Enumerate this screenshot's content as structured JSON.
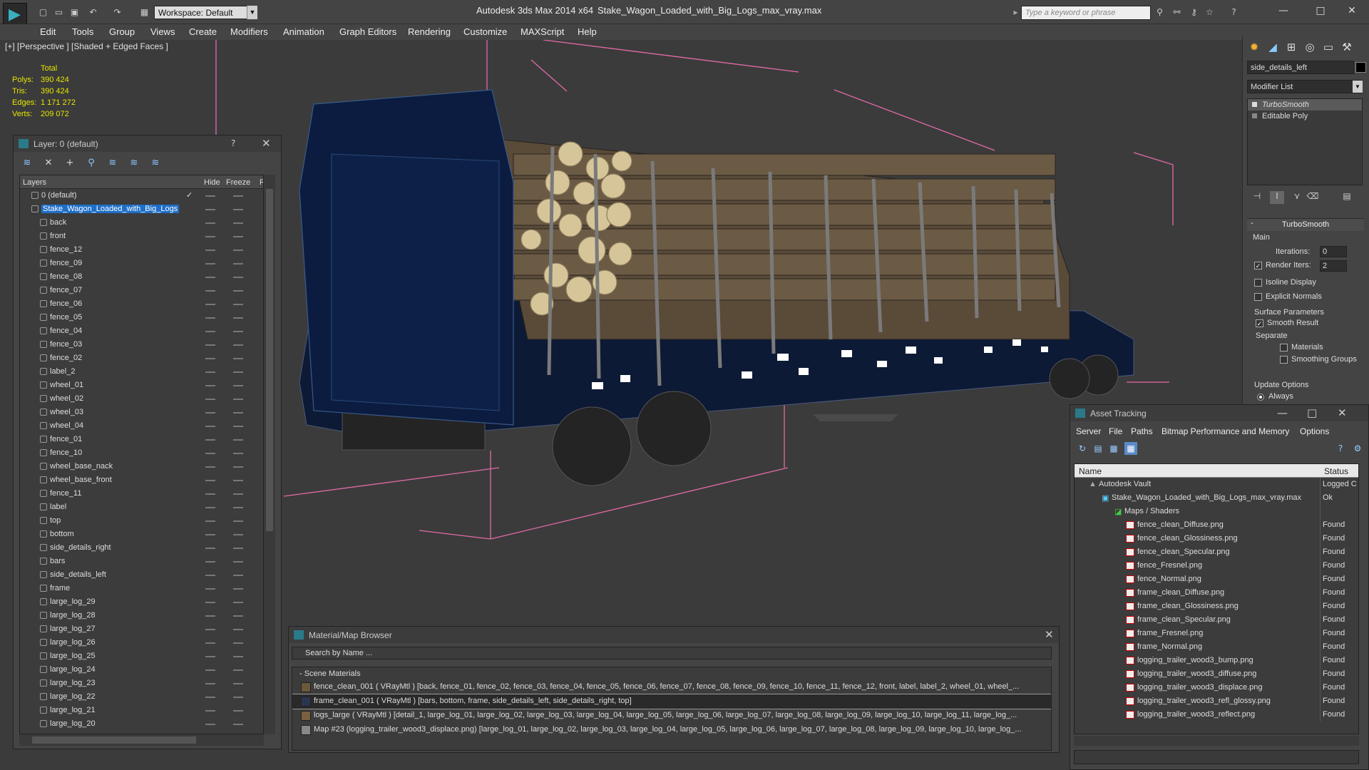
{
  "app": {
    "title": "Autodesk 3ds Max  2014 x64",
    "file": "Stake_Wagon_Loaded_with_Big_Logs_max_vray.max",
    "workspace": "Workspace: Default",
    "search_placeholder": "Type a keyword or phrase"
  },
  "menu": [
    "Edit",
    "Tools",
    "Group",
    "Views",
    "Create",
    "Modifiers",
    "Animation",
    "Graph Editors",
    "Rendering",
    "Customize",
    "MAXScript",
    "Help"
  ],
  "viewport": {
    "label": "[+] [Perspective ] [Shaded + Edged Faces ]",
    "stats_header": "Total",
    "stats": [
      {
        "label": "Polys:",
        "value": "390 424"
      },
      {
        "label": "Tris:",
        "value": "390 424"
      },
      {
        "label": "Edges:",
        "value": "1 171 272"
      },
      {
        "label": "Verts:",
        "value": "209 072"
      }
    ]
  },
  "layer_panel": {
    "title": "Layer: 0 (default)",
    "help": "?",
    "close": "✕",
    "col_layers": "Layers",
    "col_hide": "Hide",
    "col_freeze": "Freeze",
    "col_r": "R",
    "layers": [
      "0 (default)",
      "Stake_Wagon_Loaded_with_Big_Logs",
      "back",
      "front",
      "fence_12",
      "fence_09",
      "fence_08",
      "fence_07",
      "fence_06",
      "fence_05",
      "fence_04",
      "fence_03",
      "fence_02",
      "label_2",
      "wheel_01",
      "wheel_02",
      "wheel_03",
      "wheel_04",
      "fence_01",
      "fence_10",
      "wheel_base_nack",
      "wheel_base_front",
      "fence_11",
      "label",
      "top",
      "bottom",
      "side_details_right",
      "bars",
      "side_details_left",
      "frame",
      "large_log_29",
      "large_log_28",
      "large_log_27",
      "large_log_26",
      "large_log_25",
      "large_log_24",
      "large_log_23",
      "large_log_22",
      "large_log_21",
      "large_log_20"
    ]
  },
  "command_panel": {
    "object_name": "side_details_left",
    "modifier_list": "Modifier List",
    "stack": [
      "TurboSmooth",
      "Editable Poly"
    ],
    "turbosmooth": {
      "title": "TurboSmooth",
      "main": "Main",
      "iterations_label": "Iterations:",
      "iterations": "0",
      "render_iters_label": "Render Iters:",
      "render_iters": "2",
      "isoline": "Isoline Display",
      "explicit": "Explicit Normals",
      "surface": "Surface Parameters",
      "smooth_result": "Smooth Result",
      "separate": "Separate",
      "materials": "Materials",
      "smoothing_groups": "Smoothing Groups",
      "update": "Update Options",
      "always": "Always"
    }
  },
  "material_browser": {
    "title": "Material/Map Browser",
    "search": "Search by Name ...",
    "section": "- Scene Materials",
    "rows": [
      "fence_clean_001  ( VRayMtl )  [back, fence_01, fence_02, fence_03, fence_04, fence_05, fence_06, fence_07, fence_08, fence_09, fence_10, fence_11, fence_12, front, label, label_2, wheel_01, wheel_...",
      "frame_clean_001 ( VRayMtl ) [bars, bottom, frame, side_details_left, side_details_right, top]",
      "logs_large ( VRayMtl ) [detail_1, large_log_01, large_log_02, large_log_03, large_log_04, large_log_05, large_log_06, large_log_07, large_log_08, large_log_09, large_log_10, large_log_11, large_log_...",
      "Map #23 (logging_trailer_wood3_displace.png) [large_log_01, large_log_02, large_log_03, large_log_04, large_log_05, large_log_06, large_log_07, large_log_08, large_log_09, large_log_10, large_log_..."
    ]
  },
  "asset_tracking": {
    "title": "Asset Tracking",
    "menu": [
      "Server",
      "File",
      "Paths",
      "Bitmap Performance and Memory",
      "Options"
    ],
    "col_name": "Name",
    "col_status": "Status",
    "vault": "Autodesk Vault",
    "vault_status": "Logged C",
    "file": "Stake_Wagon_Loaded_with_Big_Logs_max_vray.max",
    "file_status": "Ok",
    "maps": "Maps / Shaders",
    "files": [
      "fence_clean_Diffuse.png",
      "fence_clean_Glossiness.png",
      "fence_clean_Specular.png",
      "fence_Fresnel.png",
      "fence_Normal.png",
      "frame_clean_Diffuse.png",
      "frame_clean_Glossiness.png",
      "frame_clean_Specular.png",
      "frame_Fresnel.png",
      "frame_Normal.png",
      "logging_trailer_wood3_bump.png",
      "logging_trailer_wood3_diffuse.png",
      "logging_trailer_wood3_displace.png",
      "logging_trailer_wood3_refl_glossy.png",
      "logging_trailer_wood3_reflect.png"
    ],
    "found": "Found"
  }
}
